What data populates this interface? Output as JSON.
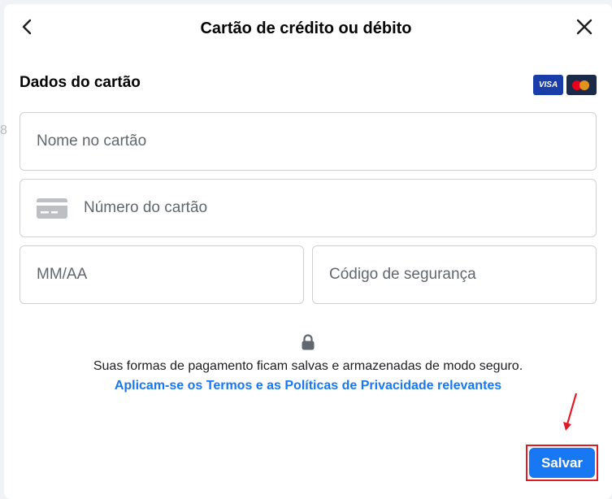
{
  "dialog": {
    "title": "Cartão de crédito ou débito",
    "back_icon": "chevron-left-icon",
    "close_icon": "close-icon"
  },
  "card_section": {
    "title": "Dados do cartão",
    "brands": {
      "visa": "VISA",
      "mastercard_icon": "mastercard-logo"
    }
  },
  "form": {
    "name_placeholder": "Nome no cartão",
    "number_placeholder": "Número do cartão",
    "expiry_placeholder": "MM/AA",
    "cvv_placeholder": "Código de segurança",
    "card_icon": "credit-card-icon"
  },
  "security": {
    "lock_icon": "lock-icon",
    "text": "Suas formas de pagamento ficam salvas e armazenadas de modo seguro.",
    "terms_link": "Aplicam-se os Termos e as Políticas de Privacidade relevantes"
  },
  "actions": {
    "save_label": "Salvar"
  },
  "colors": {
    "accent": "#1877f2",
    "highlight": "#e01b24"
  }
}
